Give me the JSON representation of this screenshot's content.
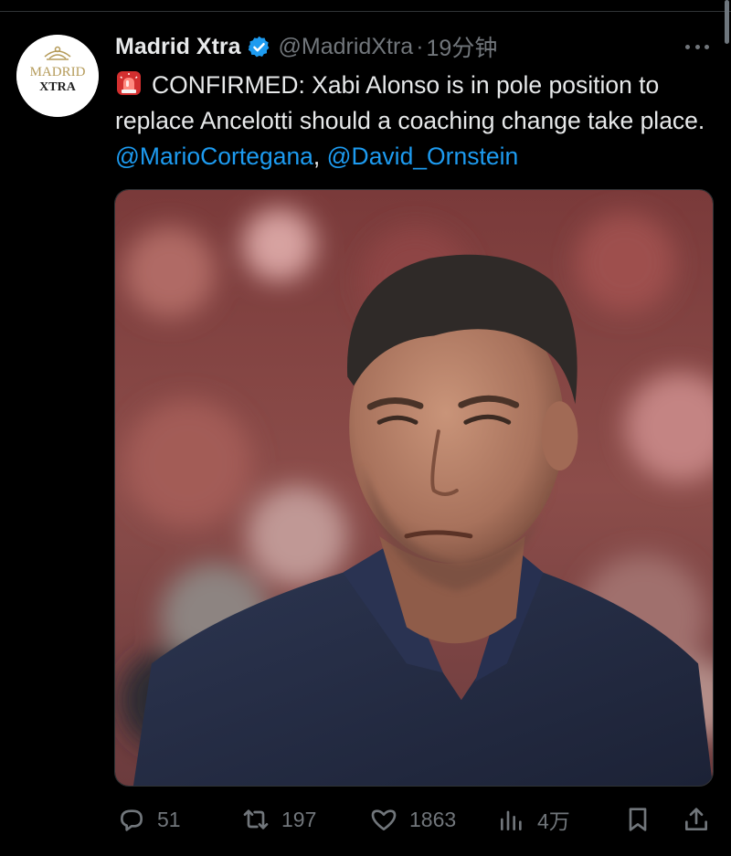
{
  "tweet": {
    "author_name": "Madrid Xtra",
    "handle": "@MadridXtra",
    "separator": "·",
    "time": "19分钟",
    "avatar_text_line1": "MADRID",
    "avatar_text_line2": "XTRA",
    "text_main": "CONFIRMED: Xabi Alonso is in pole position to replace Ancelotti should a coaching change take place. ",
    "mention1": "@MarioCortegana",
    "comma": ", ",
    "mention2": "@David_Ornstein"
  },
  "icons": {
    "verified": "verified-badge-icon",
    "emoji": "rotating-light-emoji-icon",
    "more": "more-icon",
    "reply": "reply-icon",
    "retweet": "retweet-icon",
    "like": "like-icon",
    "views": "views-icon",
    "bookmark": "bookmark-icon",
    "share": "share-icon"
  },
  "actions": {
    "replies": "51",
    "retweets": "197",
    "likes": "1863",
    "views": "4万"
  },
  "colors": {
    "background": "#000000",
    "text": "#e7e9ea",
    "muted": "#71767b",
    "link": "#1d9bf0",
    "verified": "#1d9bf0"
  }
}
